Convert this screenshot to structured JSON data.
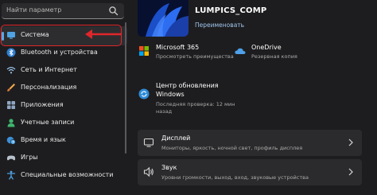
{
  "search": {
    "placeholder": "Найти параметр"
  },
  "sidebar": {
    "items": [
      {
        "label": "Система",
        "icon": "monitor-icon"
      },
      {
        "label": "Bluetooth и устройства",
        "icon": "bluetooth-icon"
      },
      {
        "label": "Сеть и Интернет",
        "icon": "wifi-icon"
      },
      {
        "label": "Персонализация",
        "icon": "brush-icon"
      },
      {
        "label": "Приложения",
        "icon": "apps-icon"
      },
      {
        "label": "Учетные записи",
        "icon": "user-icon"
      },
      {
        "label": "Время и язык",
        "icon": "clock-globe-icon"
      },
      {
        "label": "Игры",
        "icon": "gamepad-icon"
      },
      {
        "label": "Специальные возможности",
        "icon": "accessibility-icon"
      }
    ]
  },
  "profile": {
    "name": "LUMPICS_COMP",
    "rename_link": "Переименовать"
  },
  "tiles": {
    "microsoft365": {
      "title": "Microsoft 365",
      "subtitle": "Просмотреть преимущества"
    },
    "onedrive": {
      "title": "OneDrive",
      "subtitle": "Резервная копия"
    },
    "update": {
      "title_line1": "Центр обновления",
      "title_line2": "Windows",
      "subtitle_line1": "Последняя проверка: 12 мин",
      "subtitle_line2": "назад"
    }
  },
  "cards": [
    {
      "title": "Дисплей",
      "subtitle": "Мониторы, яркость, ночной свет, профиль дисплея",
      "icon": "display-icon"
    },
    {
      "title": "Звук",
      "subtitle": "Уровни громкости, выход, вход, звуковые устройства",
      "icon": "speaker-icon"
    }
  ],
  "colors": {
    "accent": "#5aa7e6",
    "highlight": "#e0262a",
    "background": "#1d1d1f",
    "card": "#2b2b2d"
  }
}
